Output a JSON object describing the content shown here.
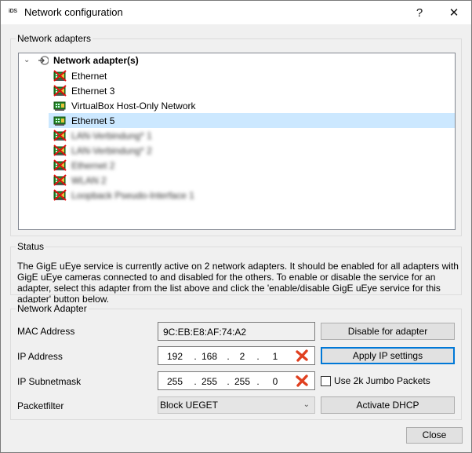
{
  "window": {
    "app_logo": "iDS",
    "title": "Network configuration",
    "help_label": "?",
    "close_label": "✕"
  },
  "adapters_group": {
    "label": "Network adapters",
    "root": {
      "label": "Network adapter(s)",
      "expanded": true,
      "icon": "network-root-icon"
    },
    "items": [
      {
        "label": "Ethernet",
        "status": "disabled",
        "icon": "nic-disabled-icon",
        "selected": false,
        "blurred": false
      },
      {
        "label": "Ethernet 3",
        "status": "disabled",
        "icon": "nic-disabled-icon",
        "selected": false,
        "blurred": false
      },
      {
        "label": "VirtualBox Host-Only Network",
        "status": "enabled",
        "icon": "nic-enabled-icon",
        "selected": false,
        "blurred": false
      },
      {
        "label": "Ethernet 5",
        "status": "enabled",
        "icon": "nic-enabled-icon",
        "selected": true,
        "blurred": false
      },
      {
        "label": "LAN-Verbindung* 1",
        "status": "disabled",
        "icon": "nic-disabled-icon",
        "selected": false,
        "blurred": true
      },
      {
        "label": "LAN-Verbindung* 2",
        "status": "disabled",
        "icon": "nic-disabled-icon",
        "selected": false,
        "blurred": true
      },
      {
        "label": "Ethernet 2",
        "status": "disabled",
        "icon": "nic-disabled-icon",
        "selected": false,
        "blurred": true
      },
      {
        "label": "WLAN 2",
        "status": "disabled",
        "icon": "nic-disabled-icon",
        "selected": false,
        "blurred": true
      },
      {
        "label": "Loopback Pseudo-Interface 1",
        "status": "disabled",
        "icon": "nic-disabled-icon",
        "selected": false,
        "blurred": true
      }
    ]
  },
  "status_group": {
    "label": "Status",
    "text": "The GigE uEye service is currently active on 2 network adapters. It should be enabled for all adapters with GigE uEye cameras connected to and disabled for the others. To enable or disable the service for an adapter, select this adapter from the list above and click the 'enable/disable GigE uEye service for this adapter' button below."
  },
  "adapter_group": {
    "label": "Network Adapter",
    "mac_label": "MAC Address",
    "mac_value": "9C:EB:E8:AF:74:A2",
    "ip_label": "IP Address",
    "ip_value": [
      "192",
      "168",
      "2",
      "1"
    ],
    "subnet_label": "IP Subnetmask",
    "subnet_value": [
      "255",
      "255",
      "255",
      "0"
    ],
    "ip_separator": ".",
    "packetfilter_label": "Packetfilter",
    "packetfilter_value": "Block UEGET",
    "disable_button": "Disable for adapter",
    "apply_button": "Apply IP settings",
    "jumbo_label": "Use 2k Jumbo Packets",
    "jumbo_checked": false,
    "dhcp_button": "Activate DHCP"
  },
  "footer": {
    "close_button": "Close"
  },
  "colors": {
    "selection": "#cce8ff",
    "default_button_border": "#0078d7",
    "clear_icon": "#e04020",
    "nic_green": "#2a8a2a"
  }
}
